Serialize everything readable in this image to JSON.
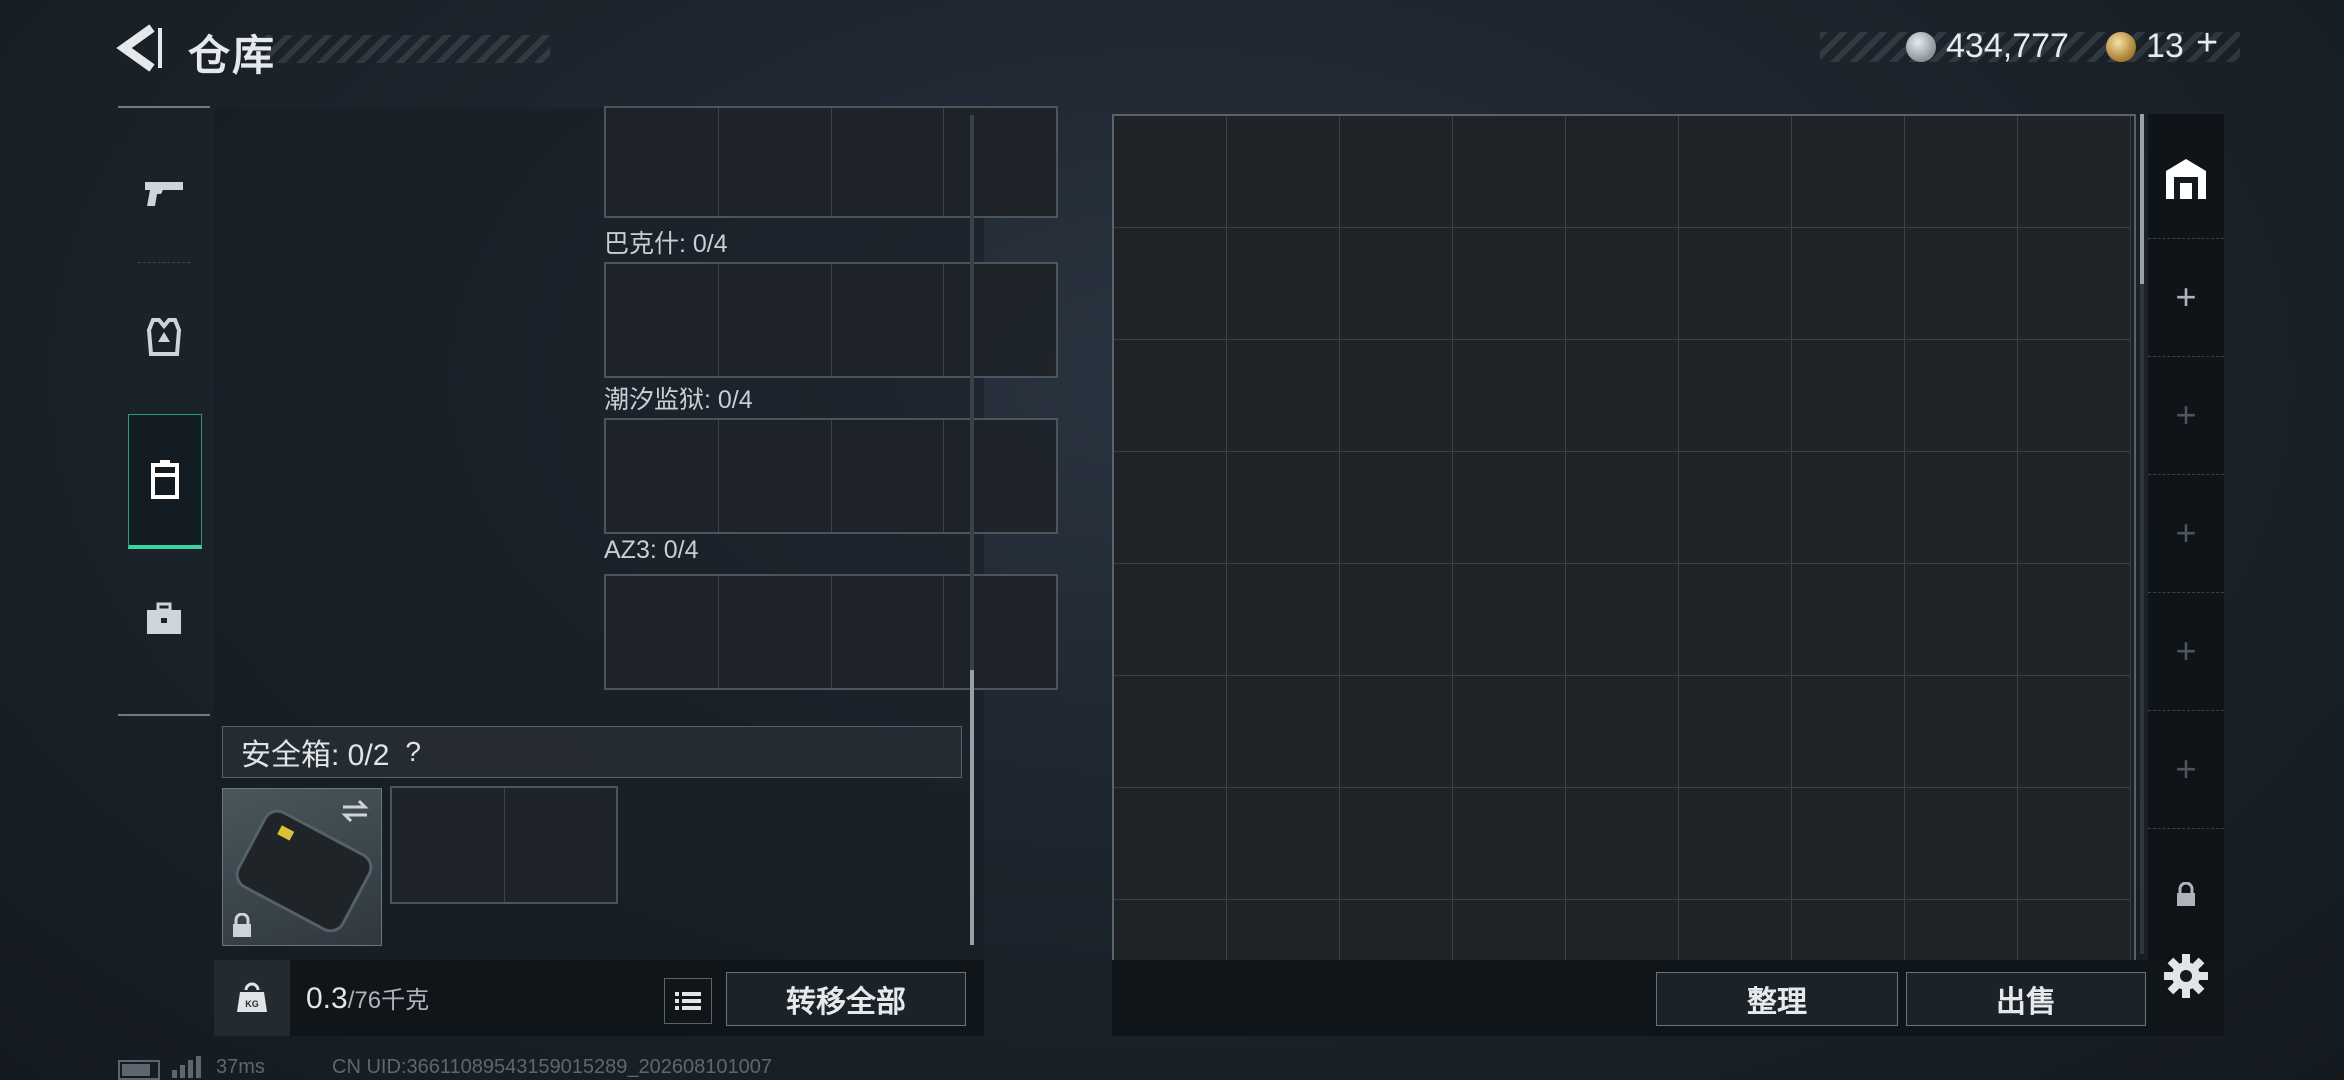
{
  "header": {
    "title": "仓库",
    "currency_silver": "434,777",
    "currency_gold": "13",
    "add_label": "+"
  },
  "left_panel": {
    "slots": [
      {
        "label": "巴克什: 0/4"
      },
      {
        "label": "潮汐监狱: 0/4"
      },
      {
        "label": "AZ3: 0/4"
      }
    ],
    "safebox": {
      "label": "安全箱: 0/2",
      "help": "?"
    },
    "weight": {
      "current": "0.3",
      "capacity": "/76千克"
    },
    "transfer_all_label": "转移全部"
  },
  "right_panel": {
    "organize_label": "整理",
    "sell_label": "出售",
    "side_tabs": [
      "+",
      "+",
      "+",
      "+",
      "+"
    ]
  },
  "footer": {
    "ping": "37ms",
    "uid": "CN UID:3661108954315901528​9_202608101007"
  },
  "icons": [
    "back-icon",
    "pistol-icon",
    "armor-icon",
    "backpack-icon",
    "briefcase-icon",
    "weight-icon",
    "list-icon",
    "swap-icon",
    "lock-icon",
    "storage-icon",
    "plus-icon",
    "settings-icon"
  ],
  "colors": {
    "accent": "#3bd4a0",
    "panel_border": "#5a636a"
  }
}
